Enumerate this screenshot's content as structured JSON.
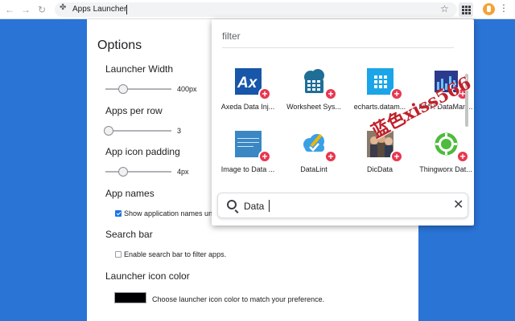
{
  "browser": {
    "tab_title": "Apps Launcher",
    "back": "←",
    "forward": "→",
    "reload": "↻",
    "puzzle": "✤",
    "star": "☆",
    "menu": "⋮"
  },
  "options": {
    "title": "Options",
    "launcher_width": {
      "label": "Launcher Width",
      "value": "400px"
    },
    "apps_per_row": {
      "label": "Apps per row",
      "value": "3"
    },
    "icon_padding": {
      "label": "App icon padding",
      "value": "4px"
    },
    "app_names": {
      "label": "App names",
      "checkbox_label": "Show application names und",
      "checked": true
    },
    "search_bar": {
      "label": "Search bar",
      "checkbox_label": "Enable search bar to filter apps.",
      "checked": false
    },
    "icon_color": {
      "label": "Launcher icon color",
      "description": "Choose launcher icon color to match your preference.",
      "color": "#000000"
    }
  },
  "popup": {
    "filter_label": "filter",
    "apps": [
      {
        "name": "Axeda Data Inj...",
        "icon": "axeda-icon"
      },
      {
        "name": "Worksheet Sys...",
        "icon": "worksheet-cloud-icon"
      },
      {
        "name": "echarts.datam...",
        "icon": "echarts-grid-icon"
      },
      {
        "name": "HMH DataMan...",
        "icon": "hmh-datamanager-icon"
      },
      {
        "name": "Image to Data ...",
        "icon": "image-to-data-icon"
      },
      {
        "name": "DataLint",
        "icon": "datalint-cloud-icon"
      },
      {
        "name": "DicData",
        "icon": "dicdata-photo-icon"
      },
      {
        "name": "Thingworx Dat...",
        "icon": "thingworx-gear-icon"
      }
    ],
    "plus_symbol": "+",
    "search_value": "Data",
    "clear_symbol": "✕"
  },
  "watermark": "蓝色xiss566",
  "colors": {
    "page_bg": "#2a74d6",
    "accent_red": "#e8364f",
    "checkbox_blue": "#1a73e8"
  }
}
